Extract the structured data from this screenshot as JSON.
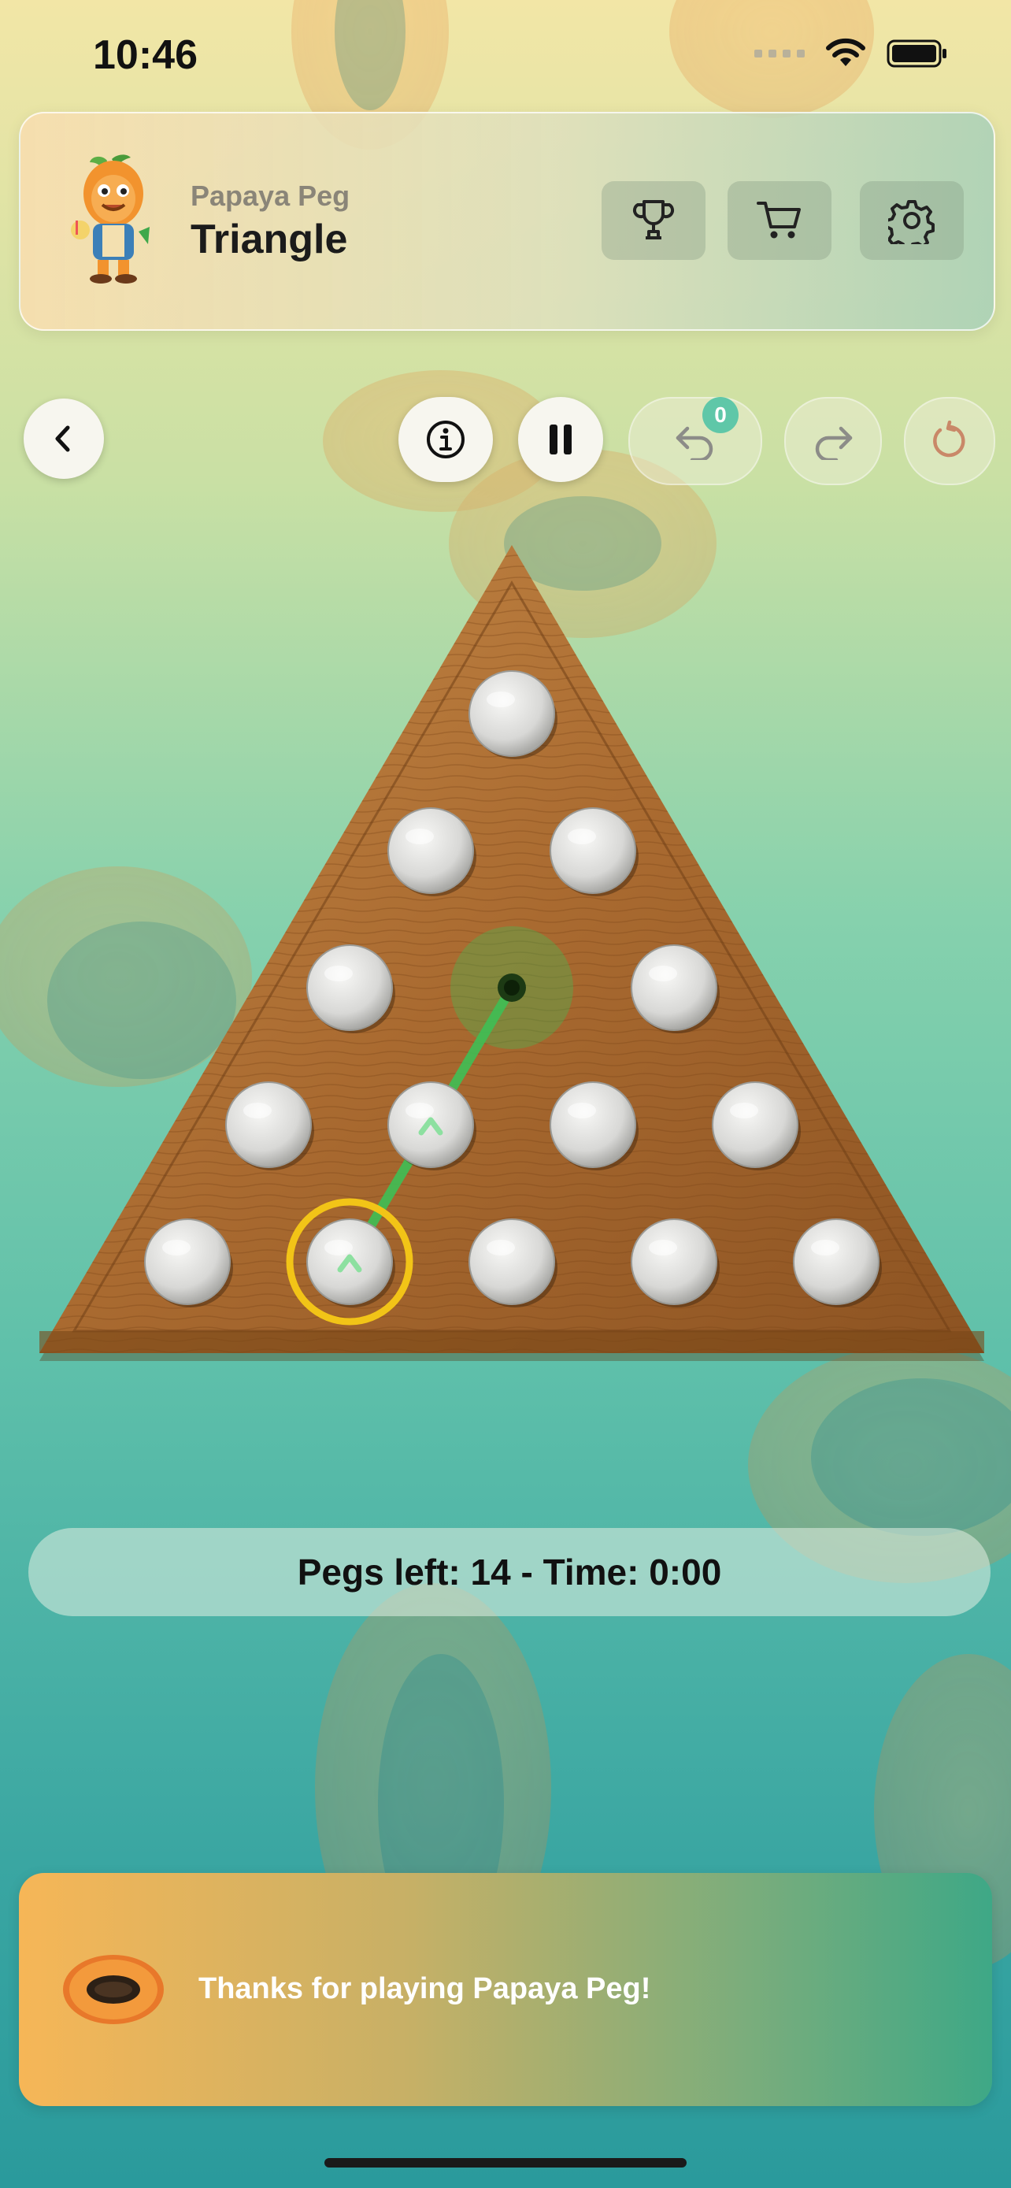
{
  "status_bar": {
    "time": "10:46"
  },
  "header": {
    "app_name": "Papaya Peg",
    "title": "Triangle",
    "buttons": [
      {
        "name": "leaderboard",
        "icon": "trophy-icon"
      },
      {
        "name": "store",
        "icon": "cart-icon"
      },
      {
        "name": "settings",
        "icon": "gear-icon"
      }
    ]
  },
  "toolbar": {
    "back_icon": "chevron-left-icon",
    "info_icon": "info-icon",
    "pause_icon": "pause-icon",
    "undo_icon": "undo-icon",
    "undo_count": "0",
    "redo_icon": "redo-icon",
    "restart_icon": "restart-icon"
  },
  "board": {
    "shape": "triangle",
    "rows": 5,
    "holes_per_row": [
      1,
      2,
      3,
      4,
      5
    ],
    "empty_hole": {
      "row": 3,
      "index": 2
    },
    "selected_peg": {
      "row": 5,
      "index": 2
    },
    "hint_jump": {
      "from": "row 5 peg 2",
      "over": "row 4 peg 2",
      "to": "row 3 hole 2"
    },
    "colors": {
      "wood": "#a86a30",
      "peg": "#dcdcdc",
      "selection_ring": "#f2c417",
      "hint_line": "#3fbf55"
    }
  },
  "game_status": "Pegs left: 14  -  Time: 0:00",
  "banner": {
    "text": "Thanks for playing Papaya Peg!",
    "icon": "papaya-icon"
  }
}
